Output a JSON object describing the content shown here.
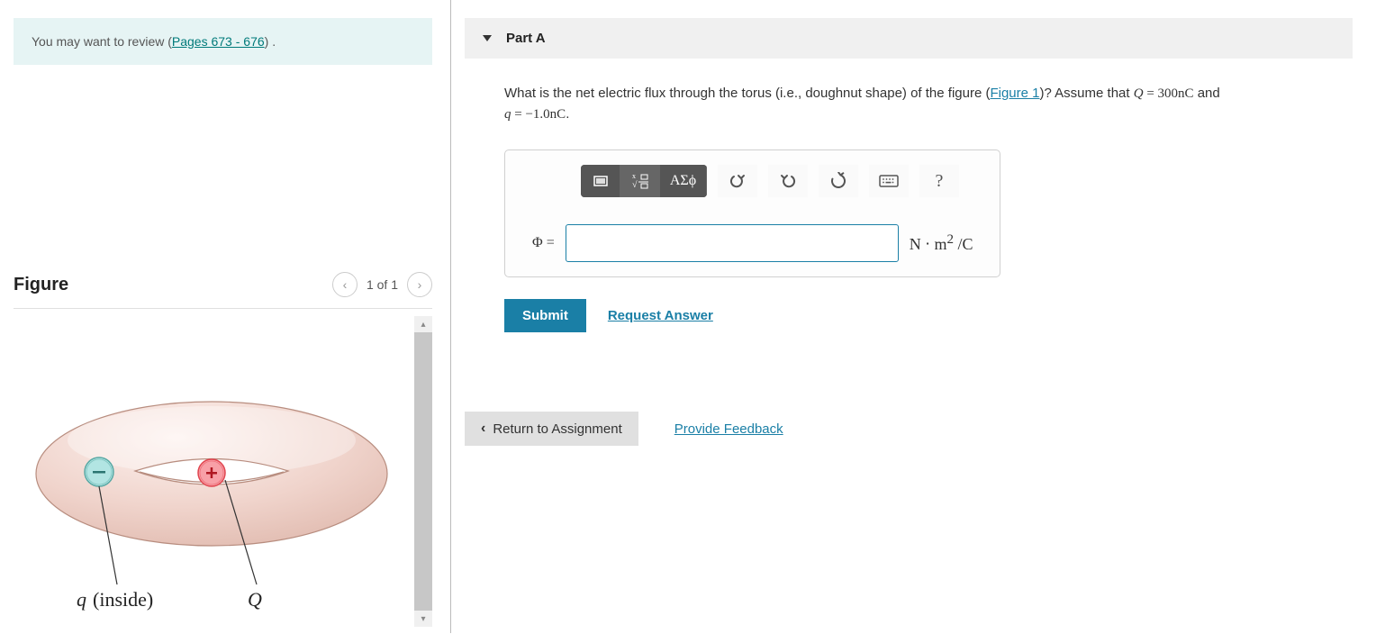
{
  "review_hint": {
    "prefix": "You may want to review (",
    "link": "Pages 673 - 676",
    "suffix": ") ."
  },
  "figure": {
    "title": "Figure",
    "nav_text": "1 of 1",
    "labels": {
      "q_inside": "q (inside)",
      "Q": "Q"
    }
  },
  "part": {
    "title": "Part A"
  },
  "question": {
    "intro": "What is the net electric flux through the torus (i.e., doughnut shape) of the figure (",
    "figure_link": "Figure 1",
    "after_link": ")? Assume that ",
    "Q_expr_var": "Q",
    "Q_expr_eq": " = ",
    "Q_expr_val": "300nC",
    "and_text": " and ",
    "q_expr_var": "q",
    "q_expr_eq": " = ",
    "q_expr_val": "−1.0nC",
    "period": "."
  },
  "toolbar": {
    "greek_btn": "ΑΣϕ"
  },
  "answer": {
    "label": "Φ =",
    "value": "",
    "units_html": "N ⋅ m² /C"
  },
  "actions": {
    "submit": "Submit",
    "request_answer": "Request Answer"
  },
  "footer": {
    "return_label": "Return to Assignment",
    "feedback": "Provide Feedback"
  }
}
